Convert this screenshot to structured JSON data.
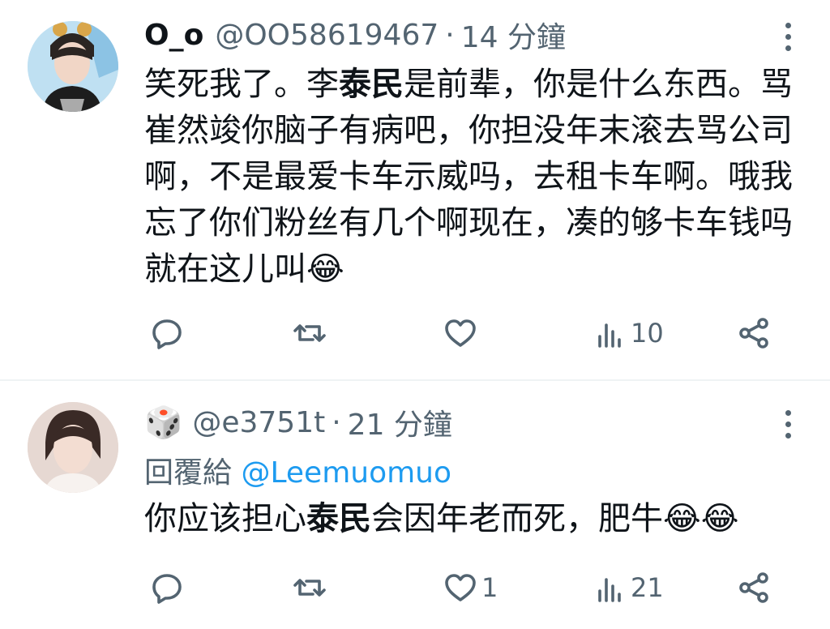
{
  "tweets": [
    {
      "name": "O_o",
      "handle": "@OO58619467",
      "time": "14 分鐘",
      "body_parts": [
        "笑死我了。李",
        "泰民",
        "是前辈，你是什么东西。骂崔然竣你脑子有病吧，你担没年末滚去骂公司啊，不是最爱卡车示威吗，去租卡车啊。哦我忘了你们粉丝有几个啊现在，凑的够卡车钱吗就在这儿叫😂"
      ],
      "replies": "",
      "retweets": "",
      "likes": "",
      "views": "10"
    },
    {
      "name_icon": "🎲",
      "handle": "@e3751t",
      "time": "21 分鐘",
      "reply_prefix": "回覆給",
      "reply_to": "@Leemuomuo",
      "body_parts": [
        "你应该担心",
        "泰民",
        "会因年老而死，肥牛😂😂"
      ],
      "replies": "",
      "retweets": "",
      "likes": "1",
      "views": "21"
    }
  ],
  "separator": "·",
  "colors": {
    "text": "#0f1419",
    "secondary": "#536471",
    "link": "#1d9bf0",
    "divider": "#eff3f4"
  },
  "icons": [
    "reply-icon",
    "retweet-icon",
    "like-icon",
    "views-icon",
    "share-icon",
    "more-icon"
  ]
}
